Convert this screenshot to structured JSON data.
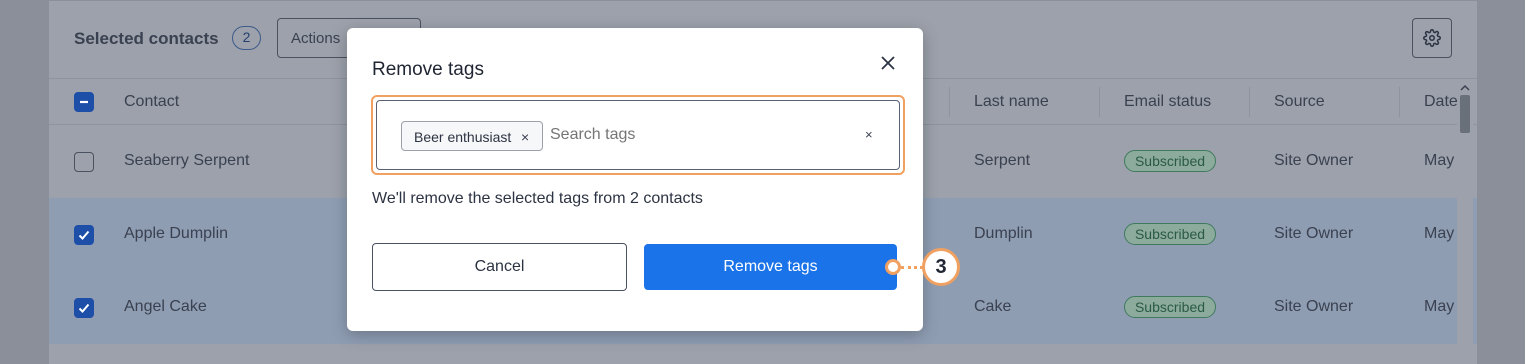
{
  "toolbar": {
    "selected_label": "Selected contacts",
    "selected_count": "2",
    "actions_label": "Actions"
  },
  "table": {
    "headers": [
      "Contact",
      "Last name",
      "Email status",
      "Source",
      "Date"
    ],
    "rows": [
      {
        "contact": "Seaberry Serpent",
        "last_name": "Serpent",
        "status": "Subscribed",
        "source": "Site Owner",
        "date": "May",
        "checked": false
      },
      {
        "contact": "Apple Dumplin",
        "last_name": "Dumplin",
        "status": "Subscribed",
        "source": "Site Owner",
        "date": "May",
        "checked": true
      },
      {
        "contact": "Angel Cake",
        "last_name": "Cake",
        "status": "Subscribed",
        "source": "Site Owner",
        "date": "May",
        "checked": true
      }
    ]
  },
  "modal": {
    "title": "Remove tags",
    "tag_chip": "Beer enthusiast",
    "search_placeholder": "Search tags",
    "info_text": "We'll remove the selected tags from 2 contacts",
    "cancel_label": "Cancel",
    "remove_label": "Remove tags"
  },
  "callout": {
    "number": "3"
  },
  "colors": {
    "accent": "#1a73e8",
    "highlight": "#f0a060",
    "subscribed": "#3f7a5d"
  }
}
